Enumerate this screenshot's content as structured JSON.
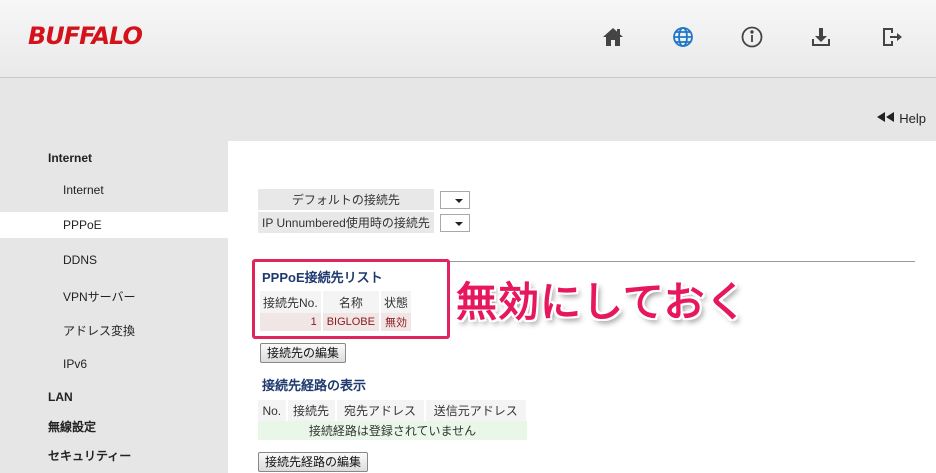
{
  "header": {
    "logo": "BUFFALO",
    "icons": [
      "home-icon",
      "globe-icon",
      "info-icon",
      "download-icon",
      "logout-icon"
    ],
    "brand_color": "#d3121b"
  },
  "help": {
    "label": "Help"
  },
  "sidebar": {
    "items": [
      {
        "label": "Internet",
        "kind": "category"
      },
      {
        "label": "Internet",
        "kind": "sub"
      },
      {
        "label": "PPPoE",
        "kind": "sub",
        "active": true
      },
      {
        "label": "DDNS",
        "kind": "sub"
      },
      {
        "label": "VPNサーバー",
        "kind": "sub"
      },
      {
        "label": "アドレス変換",
        "kind": "sub"
      },
      {
        "label": "IPv6",
        "kind": "sub"
      },
      {
        "label": "LAN",
        "kind": "category"
      },
      {
        "label": "無線設定",
        "kind": "category"
      },
      {
        "label": "セキュリティー",
        "kind": "category"
      }
    ]
  },
  "defaults": {
    "rows": [
      {
        "label": "デフォルトの接続先",
        "value": ""
      },
      {
        "label": "IP Unnumbered使用時の接続先",
        "value": ""
      }
    ]
  },
  "pppoe_list": {
    "title": "PPPoE接続先リスト",
    "headers": [
      "接続先No.",
      "名称",
      "状態"
    ],
    "rows": [
      {
        "no": "1",
        "name": "BIGLOBE",
        "status": "無効"
      }
    ],
    "edit_button": "接続先の編集"
  },
  "routes": {
    "title": "接続先経路の表示",
    "headers": [
      "No.",
      "接続先",
      "宛先アドレス",
      "送信元アドレス"
    ],
    "empty_message": "接続経路は登録されていません",
    "edit_button": "接続先経路の編集"
  },
  "annotation": {
    "text": "無効にしておく",
    "color": "#e6175c"
  }
}
